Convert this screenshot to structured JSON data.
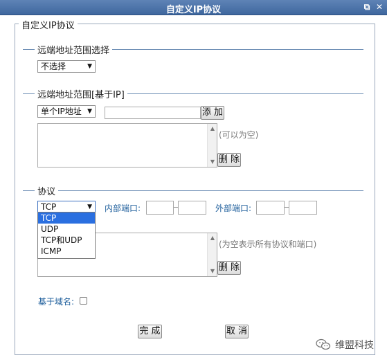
{
  "window": {
    "title": "自定义IP协议",
    "restore_icon": "restore-icon",
    "close_icon": "close-icon"
  },
  "form": {
    "legend": "自定义IP协议",
    "remote_range_select": {
      "title": "远端地址范围选择",
      "selected": "不选择"
    },
    "remote_range_ip": {
      "title": "远端地址范围[基于IP]",
      "type_selected": "单个IP地址",
      "ip_value": "",
      "add_label": "添 加",
      "list_hint": "(可以为空)",
      "delete_label": "删 除"
    },
    "protocol": {
      "title": "协议",
      "selected": "TCP",
      "options": [
        "TCP",
        "UDP",
        "TCP和UDP",
        "ICMP"
      ],
      "internal_port_label": "内部端口:",
      "external_port_label": "外部端口:",
      "list_hint": "(为空表示所有协议和端口)",
      "delete_label": "删 除"
    },
    "domain": {
      "label": "基于域名:",
      "checked": false
    },
    "actions": {
      "ok_label": "完 成",
      "cancel_label": "取 消"
    }
  },
  "watermark": {
    "text": "维盟科技"
  }
}
